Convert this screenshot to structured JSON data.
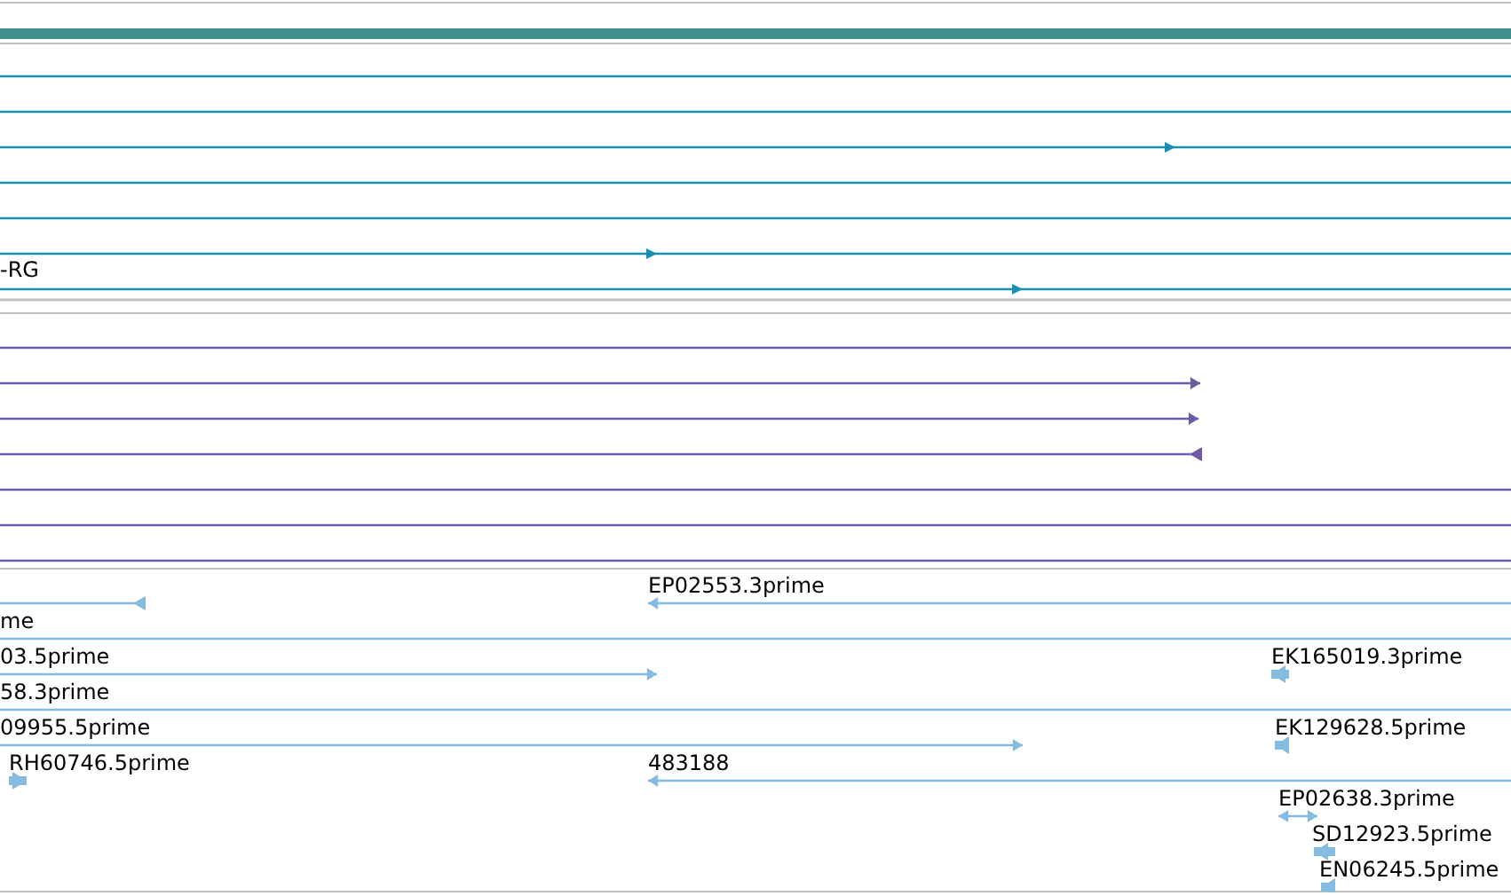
{
  "gene_track": {
    "labels": [
      {
        "text": "-RG"
      }
    ]
  },
  "est_track": {
    "labels": [
      {
        "text": "EP02553.3prime"
      },
      {
        "text": "me"
      },
      {
        "text": "03.5prime"
      },
      {
        "text": "EK165019.3prime"
      },
      {
        "text": "58.3prime"
      },
      {
        "text": "09955.5prime"
      },
      {
        "text": "EK129628.5prime"
      },
      {
        "text": "RH60746.5prime"
      },
      {
        "text": "483188"
      },
      {
        "text": "EP02638.3prime"
      },
      {
        "text": "SD12923.5prime"
      },
      {
        "text": "EN06245.5prime"
      }
    ]
  }
}
